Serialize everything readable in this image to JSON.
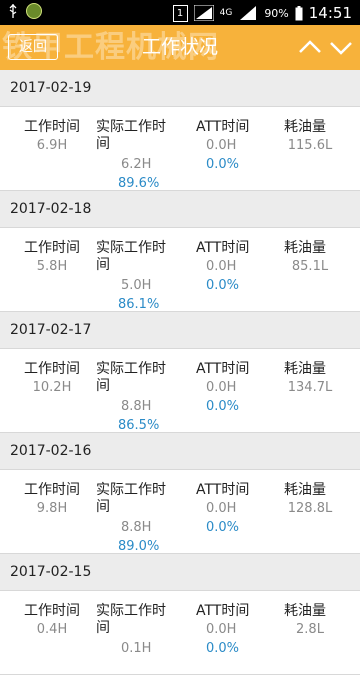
{
  "status_bar": {
    "network": "4G",
    "battery": "90%",
    "time": "14:51"
  },
  "header": {
    "back_label": "返回",
    "title": "工作状况"
  },
  "watermark": "铁甲工程机械网 tiejiahome.com",
  "columns": {
    "work_time": "工作时间",
    "actual_work_time": "实际工作时间",
    "att_time": "ATT时间",
    "fuel": "耗油量"
  },
  "entries": [
    {
      "date": "2017-02-19",
      "work_time": "6.9H",
      "actual_time": "6.2H",
      "actual_pct": "89.6%",
      "att_time": "0.0H",
      "att_pct": "0.0%",
      "fuel": "115.6L"
    },
    {
      "date": "2017-02-18",
      "work_time": "5.8H",
      "actual_time": "5.0H",
      "actual_pct": "86.1%",
      "att_time": "0.0H",
      "att_pct": "0.0%",
      "fuel": "85.1L"
    },
    {
      "date": "2017-02-17",
      "work_time": "10.2H",
      "actual_time": "8.8H",
      "actual_pct": "86.5%",
      "att_time": "0.0H",
      "att_pct": "0.0%",
      "fuel": "134.7L"
    },
    {
      "date": "2017-02-16",
      "work_time": "9.8H",
      "actual_time": "8.8H",
      "actual_pct": "89.0%",
      "att_time": "0.0H",
      "att_pct": "0.0%",
      "fuel": "128.8L"
    },
    {
      "date": "2017-02-15",
      "work_time": "0.4H",
      "actual_time": "0.1H",
      "actual_pct": "",
      "att_time": "0.0H",
      "att_pct": "0.0%",
      "fuel": "2.8L"
    }
  ]
}
